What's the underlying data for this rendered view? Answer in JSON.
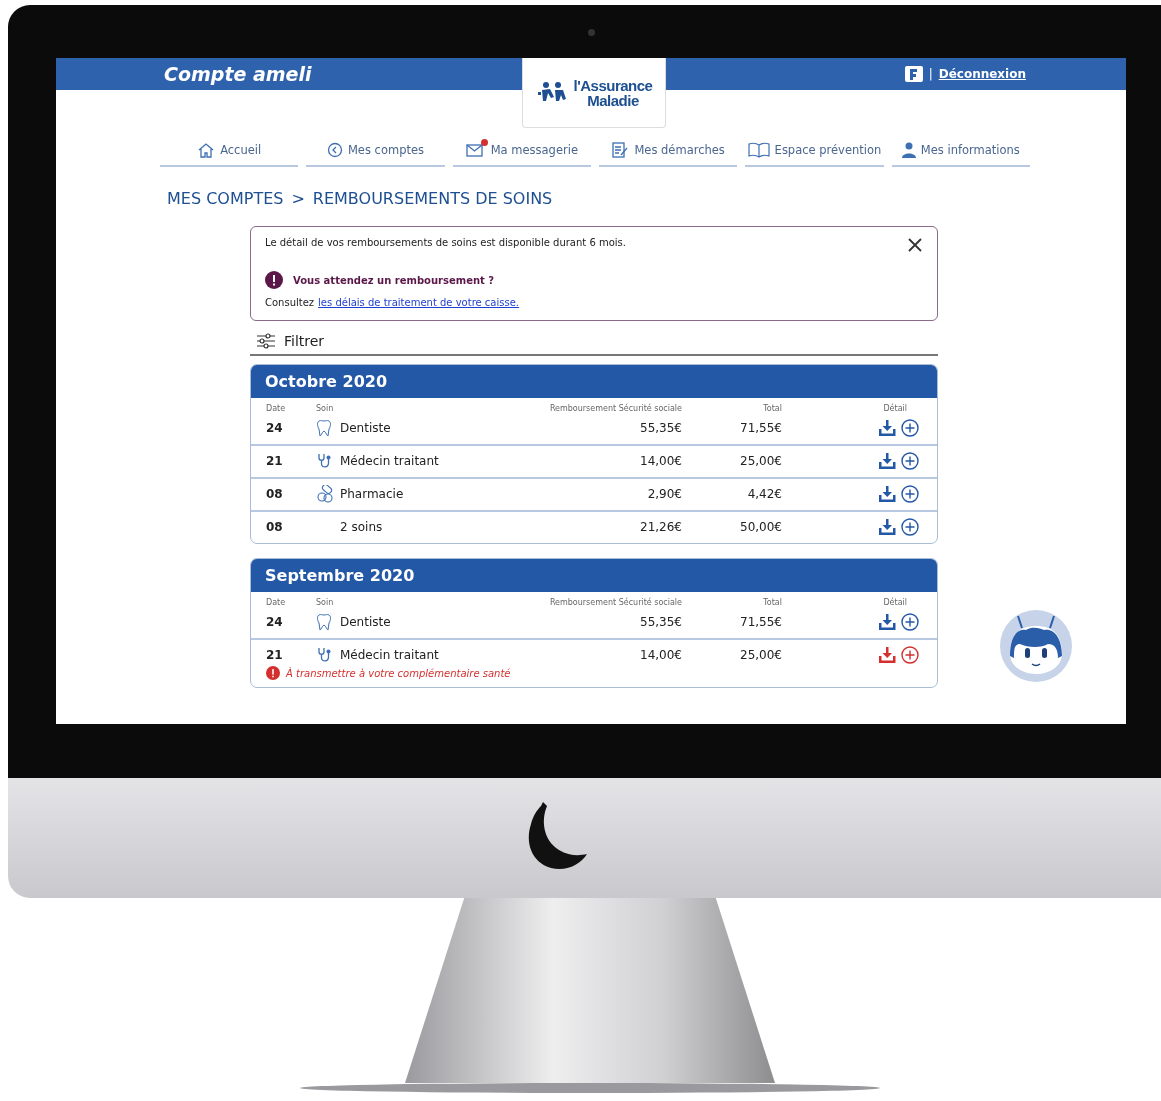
{
  "header": {
    "title": "Compte ameli",
    "logo": {
      "line1": "l'Assurance",
      "line2": "Maladie"
    },
    "logout": "Déconnexion",
    "separator": "|"
  },
  "nav": [
    {
      "label": "Accueil",
      "kind": "home",
      "notification": false
    },
    {
      "label": "Mes comptes",
      "kind": "back",
      "notification": false
    },
    {
      "label": "Ma messagerie",
      "kind": "mail",
      "notification": true
    },
    {
      "label": "Mes démarches",
      "kind": "form",
      "notification": false
    },
    {
      "label": "Espace prévention",
      "kind": "book",
      "notification": false
    },
    {
      "label": "Mes informations",
      "kind": "person",
      "notification": false
    }
  ],
  "breadcrumb": {
    "parent": "MES COMPTES",
    "separator": ">",
    "current": "REMBOURSEMENTS DE SOINS"
  },
  "notice": {
    "text": "Le détail de vos remboursements de soins est  disponible durant 6 mois.",
    "alert_title": "Vous attendez un remboursement ?",
    "lead": "Consultez",
    "link": "les délais de traitement de votre caisse."
  },
  "filter": {
    "label": "Filtrer"
  },
  "months": [
    {
      "title": "Octobre 2020",
      "columns": [
        "Date",
        "Soin",
        "Remboursement Sécurité sociale",
        "Total",
        "Détail"
      ],
      "rows": [
        {
          "date": "24",
          "kind": "tooth",
          "soin": "Dentiste",
          "remb": "55,35€",
          "total": "71,55€",
          "warning": false
        },
        {
          "date": "21",
          "kind": "stethoscope",
          "soin": "Médecin traitant",
          "remb": "14,00€",
          "total": "25,00€",
          "warning": false
        },
        {
          "date": "08",
          "kind": "pills",
          "soin": "Pharmacie",
          "remb": "2,90€",
          "total": "4,42€",
          "warning": false
        },
        {
          "date": "08",
          "kind": "none",
          "soin": "2 soins",
          "remb": "21,26€",
          "total": "50,00€",
          "warning": false
        }
      ]
    },
    {
      "title": "Septembre 2020",
      "columns": [
        "Date",
        "Soin",
        "Remboursement Sécurité sociale",
        "Total",
        "Détail"
      ],
      "rows": [
        {
          "date": "24",
          "kind": "tooth",
          "soin": "Dentiste",
          "remb": "55,35€",
          "total": "71,55€",
          "warning": false
        },
        {
          "date": "21",
          "kind": "stethoscope",
          "soin": "Médecin traitant",
          "remb": "14,00€",
          "total": "25,00€",
          "warning": true,
          "warning_text": "À transmettre à votre complémentaire santé"
        }
      ]
    }
  ]
}
